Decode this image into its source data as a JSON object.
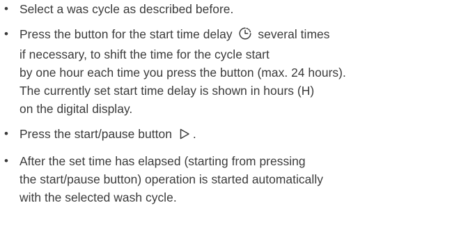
{
  "bullet": "•",
  "steps": [
    {
      "lines": [
        "Select a was cycle as described before."
      ]
    },
    {
      "line1_before_icon": "Press the button for the start time delay",
      "line1_icon": "clock-icon",
      "line1_after_icon": "several times",
      "lines": [
        "if necessary, to shift the time for the cycle start",
        "by one hour each time you press the button (max. 24 hours).",
        "The currently set start time delay is shown in hours (H)",
        "on the digital display."
      ]
    },
    {
      "before_icon": "Press the start/pause button",
      "icon": "play-triangle-icon",
      "after_icon": "."
    },
    {
      "lines": [
        "After the set time has elapsed (starting from pressing",
        "the start/pause button) operation is started automatically",
        "with the selected wash cycle."
      ]
    }
  ]
}
